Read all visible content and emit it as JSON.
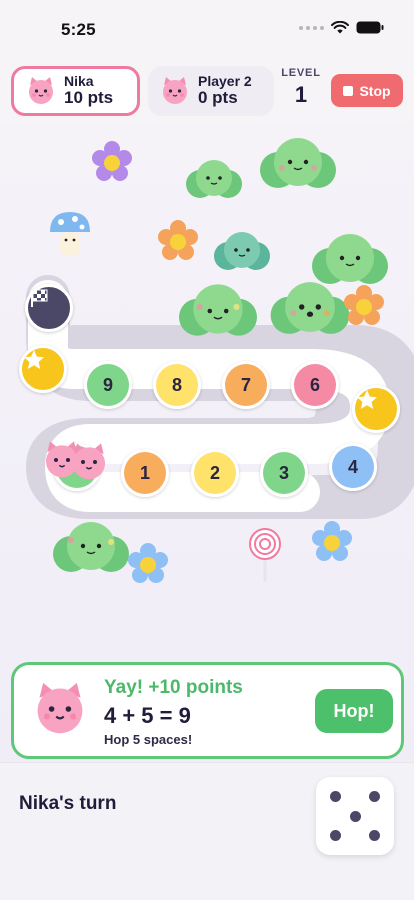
{
  "status": {
    "time": "5:25"
  },
  "players": [
    {
      "name": "Nika",
      "points": "10 pts",
      "active": true
    },
    {
      "name": "Player 2",
      "points": "0 pts",
      "active": false
    }
  ],
  "level": {
    "label": "LEVEL",
    "value": "1"
  },
  "stop_label": "Stop",
  "board": {
    "spaces": [
      {
        "label": "1",
        "color": "#f7ad5c"
      },
      {
        "label": "2",
        "color": "#ffe26a"
      },
      {
        "label": "3",
        "color": "#7fd68a"
      },
      {
        "label": "4",
        "color": "#8ec0f5"
      },
      {
        "label": "6",
        "color": "#f58aa5"
      },
      {
        "label": "7",
        "color": "#f7ad5c"
      },
      {
        "label": "8",
        "color": "#ffe26a"
      },
      {
        "label": "9",
        "color": "#7fd68a"
      }
    ],
    "star_color": "#f7c51b",
    "finish_icon": "checkered-flag-icon",
    "track_color": "#ffffff"
  },
  "message": {
    "title": "Yay! +10 points",
    "equation": "4 + 5 = 9",
    "subtitle": "Hop 5 spaces!",
    "button_label": "Hop!"
  },
  "turn_text": "Nika's turn",
  "dice": {
    "value": 5
  },
  "colors": {
    "accent_pink": "#ef7aa0",
    "stop_red": "#ef6b6f",
    "success_green": "#4cc06a"
  }
}
